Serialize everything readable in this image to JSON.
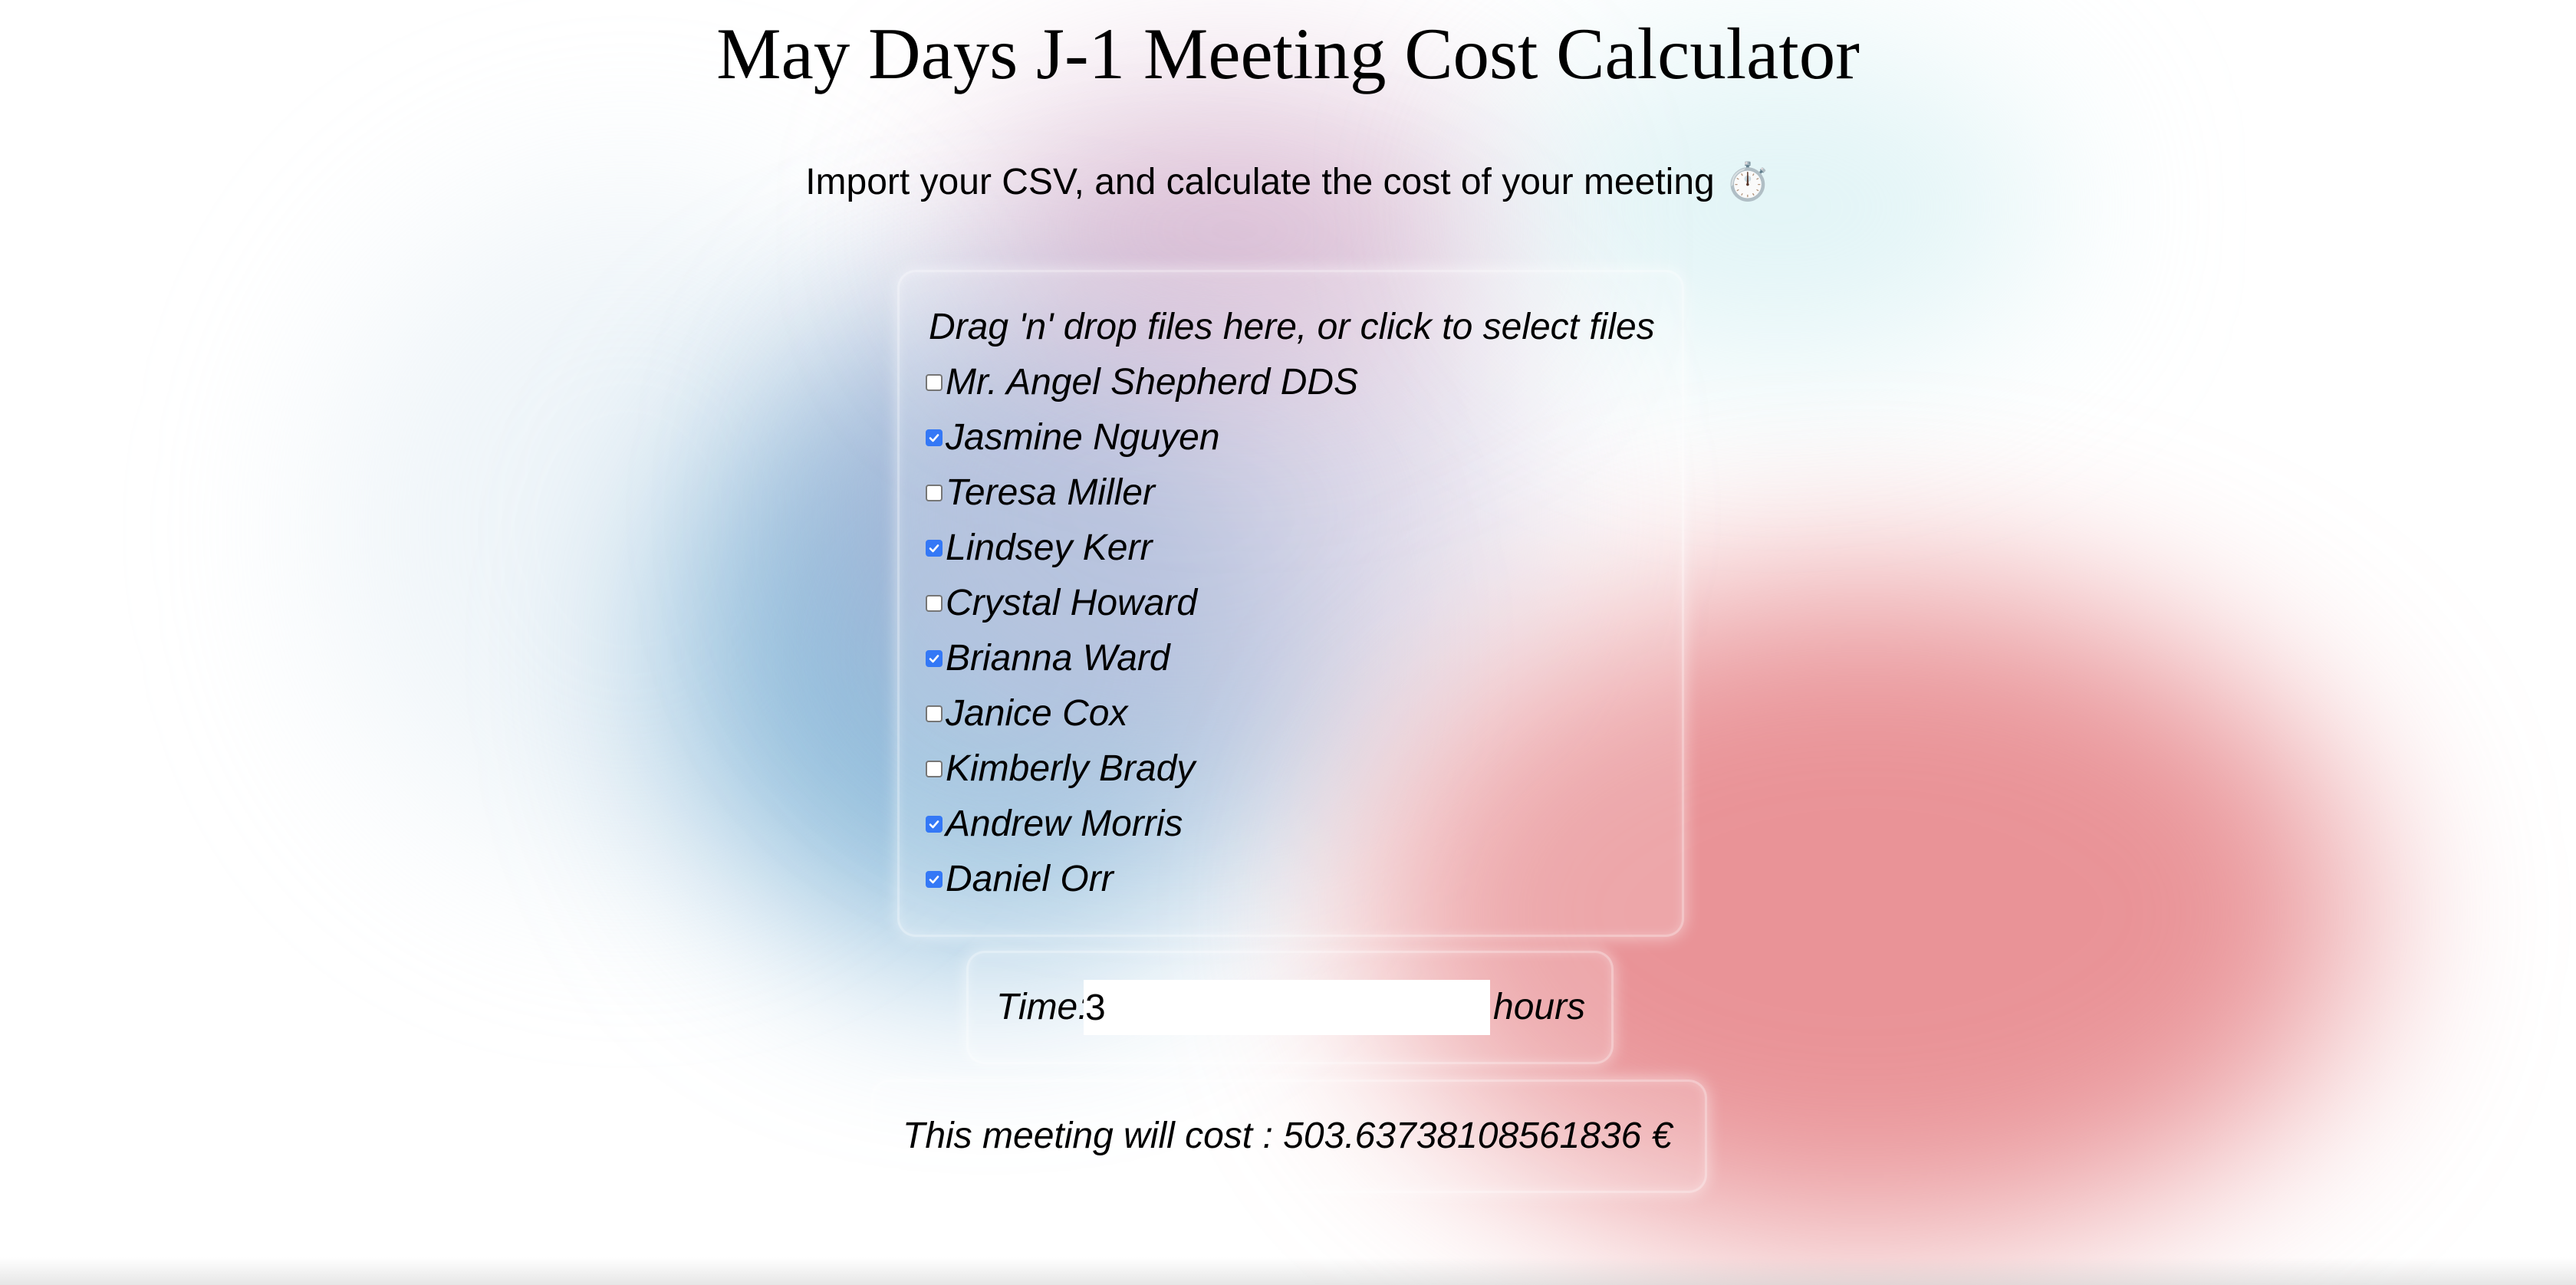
{
  "page": {
    "title": "May Days J-1 Meeting Cost Calculator",
    "subtitle": "Import your CSV, and calculate the cost of your meeting ⏱️"
  },
  "dropzone": {
    "text": "Drag 'n' drop files here, or click to select files",
    "people": [
      {
        "name": "Mr. Angel Shepherd DDS",
        "checked": false
      },
      {
        "name": "Jasmine Nguyen",
        "checked": true
      },
      {
        "name": "Teresa Miller",
        "checked": false
      },
      {
        "name": "Lindsey Kerr",
        "checked": true
      },
      {
        "name": "Crystal Howard",
        "checked": false
      },
      {
        "name": "Brianna Ward",
        "checked": true
      },
      {
        "name": "Janice Cox",
        "checked": false
      },
      {
        "name": "Kimberly Brady",
        "checked": false
      },
      {
        "name": "Andrew Morris",
        "checked": true
      },
      {
        "name": "Daniel Orr",
        "checked": true
      }
    ]
  },
  "time": {
    "label": "Time:",
    "value": "3",
    "unit": "hours"
  },
  "cost": {
    "text": "This meeting will cost : 503.63738108561836 €"
  },
  "colors": {
    "checkbox_checked": "#3478f6",
    "background_blue": "#6eaad2",
    "background_red": "#e4787d"
  }
}
